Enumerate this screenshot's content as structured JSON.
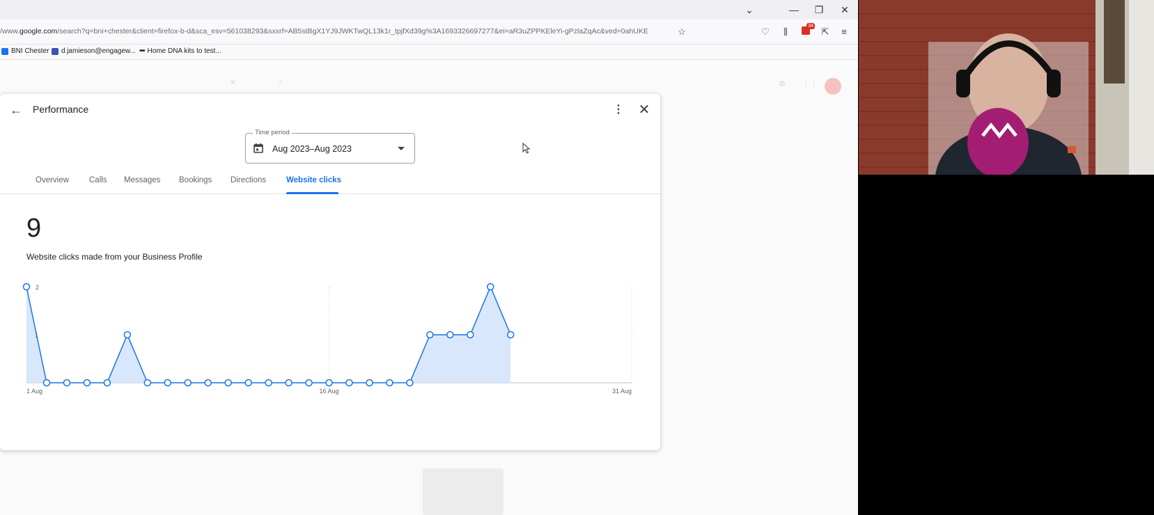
{
  "browser": {
    "url_prefix": "/www.",
    "url_domain": "google.com",
    "url_rest": "/search?q=bni+chester&client=firefox-b-d&sca_esv=561038293&sxsrf=AB5stBgX1YJ9JWKTwQL13k1r_tpjfXd39g%3A1693326697277&ei=aR3uZPPKEleYi-gPzlaZqAc&ved=0ahUKE",
    "extensions_badge": "34",
    "bookmarks": [
      {
        "label": "BNI Chester",
        "icon": "bni-icon"
      },
      {
        "label": "d.jamieson@engagew...",
        "icon": "mail-icon"
      },
      {
        "label": "Home DNA kits to test...",
        "icon": "dots-icon"
      }
    ]
  },
  "dialog": {
    "title": "Performance",
    "time_period_label": "Time period",
    "time_period_value": "Aug 2023–Aug 2023",
    "tabs": [
      "Overview",
      "Calls",
      "Messages",
      "Bookings",
      "Directions",
      "Website clicks"
    ],
    "active_tab": "Website clicks",
    "metric_value": "9",
    "metric_description": "Website clicks made from your Business Profile"
  },
  "chart_data": {
    "type": "line",
    "title": "",
    "xlabel": "",
    "ylabel": "",
    "x_tick_labels": [
      "1 Aug",
      "16 Aug",
      "31 Aug"
    ],
    "y_tick_labels": [
      "2",
      "1"
    ],
    "ylim": [
      0,
      2
    ],
    "xlim_days": [
      1,
      31
    ],
    "grid": "vertical-dashed",
    "series": [
      {
        "x": [
          "1 Aug",
          "2 Aug",
          "3 Aug",
          "4 Aug",
          "5 Aug",
          "6 Aug",
          "7 Aug",
          "8 Aug",
          "9 Aug",
          "10 Aug",
          "11 Aug",
          "12 Aug",
          "13 Aug",
          "14 Aug",
          "15 Aug",
          "16 Aug",
          "17 Aug",
          "18 Aug",
          "19 Aug",
          "20 Aug",
          "21 Aug",
          "22 Aug",
          "23 Aug",
          "24 Aug",
          "25 Aug"
        ],
        "values": [
          2,
          0,
          0,
          0,
          0,
          1,
          0,
          0,
          0,
          0,
          0,
          0,
          0,
          0,
          0,
          0,
          0,
          0,
          0,
          0,
          1,
          1,
          1,
          2,
          1
        ]
      }
    ],
    "colors": {
      "line": "#1a73e8",
      "fill": "#d2e3fc"
    }
  }
}
